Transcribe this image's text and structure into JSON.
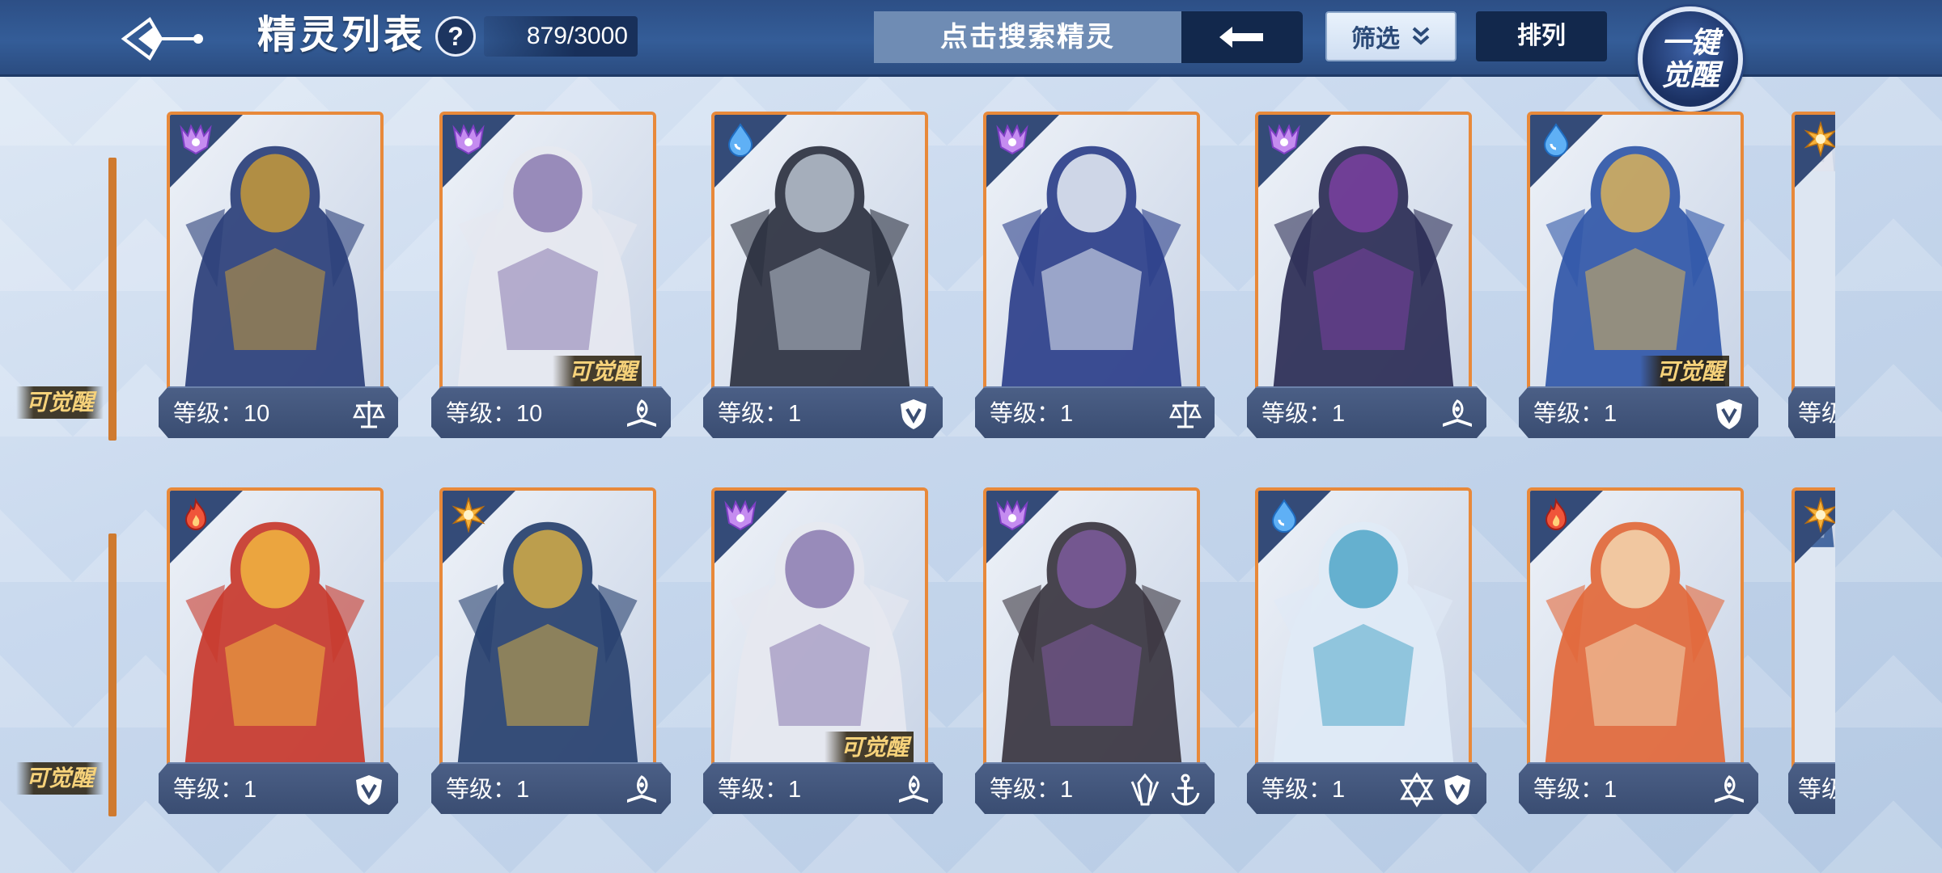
{
  "header": {
    "title": "精灵列表",
    "help_symbol": "?",
    "count": "879/3000",
    "search_placeholder": "点击搜索精灵",
    "filter_label": "筛选",
    "sort_label": "排列",
    "awaken_all_line1": "一键",
    "awaken_all_line2": "觉醒"
  },
  "colors": {
    "topbar": "#2d4f86",
    "card_frame": "#e8893a",
    "level_plate": "#3a4d72",
    "awaken_text": "#f6d27a"
  },
  "awaken_label": "可觉醒",
  "rows": [
    {
      "edge_left_awaken": "可觉醒",
      "cards": [
        {
          "element": "shadow-icon",
          "level": "等级：10",
          "class_icons": [
            "scales-icon"
          ],
          "awakenable": "",
          "art": [
            "#2b3f7a",
            "#c79a3a"
          ]
        },
        {
          "element": "shadow-icon",
          "level": "等级：10",
          "class_icons": [
            "book-icon"
          ],
          "awakenable": "可觉醒",
          "art": [
            "#e6e8f0",
            "#8a7ab0"
          ]
        },
        {
          "element": "water-icon",
          "level": "等级：1",
          "class_icons": [
            "shield-icon"
          ],
          "awakenable": "",
          "art": [
            "#2c3140",
            "#b9c2cf"
          ]
        },
        {
          "element": "shadow-icon",
          "level": "等级：1",
          "class_icons": [
            "scales-icon"
          ],
          "awakenable": "",
          "art": [
            "#2c3f8a",
            "#e9eef6"
          ]
        },
        {
          "element": "shadow-icon",
          "level": "等级：1",
          "class_icons": [
            "book-icon"
          ],
          "awakenable": "",
          "art": [
            "#2b2d55",
            "#7a3fa0"
          ]
        },
        {
          "element": "water-icon",
          "level": "等级：1",
          "class_icons": [
            "shield-icon"
          ],
          "awakenable": "可觉醒",
          "art": [
            "#3157a8",
            "#d9b25a"
          ]
        },
        {
          "element": "light-icon",
          "level": "等级",
          "class_icons": [],
          "awakenable": "",
          "art": [
            "#e3e6ef",
            "#c2c9d8"
          ],
          "partial": true
        }
      ]
    },
    {
      "edge_left_awaken": "可觉醒",
      "cards": [
        {
          "element": "fire-icon",
          "level": "等级：1",
          "class_icons": [
            "shield-icon"
          ],
          "awakenable": "",
          "art": [
            "#c8382c",
            "#f1b640"
          ]
        },
        {
          "element": "light-icon",
          "level": "等级：1",
          "class_icons": [
            "book-icon"
          ],
          "awakenable": "",
          "art": [
            "#27406e",
            "#d4ad45"
          ]
        },
        {
          "element": "shadow-icon",
          "level": "等级：1",
          "class_icons": [
            "book-icon"
          ],
          "awakenable": "可觉醒",
          "art": [
            "#e6e8f0",
            "#8a7ab0"
          ]
        },
        {
          "element": "shadow-icon",
          "level": "等级：1",
          "class_icons": [
            "claw-icon",
            "anchor-icon"
          ],
          "awakenable": "",
          "art": [
            "#3a3540",
            "#7d5a9c"
          ]
        },
        {
          "element": "water-icon",
          "level": "等级：1",
          "class_icons": [
            "star-icon",
            "shield-icon"
          ],
          "awakenable": "",
          "art": [
            "#dfeaf6",
            "#4fa6c8"
          ]
        },
        {
          "element": "fire-icon",
          "level": "等级：1",
          "class_icons": [
            "book-icon"
          ],
          "awakenable": "",
          "art": [
            "#e2683a",
            "#f3d6b0"
          ]
        },
        {
          "element": "light-icon",
          "level": "等级",
          "class_icons": [],
          "awakenable": "",
          "art": [
            "#3b5f9a",
            "#cfd8e8"
          ],
          "partial": true
        }
      ]
    }
  ]
}
